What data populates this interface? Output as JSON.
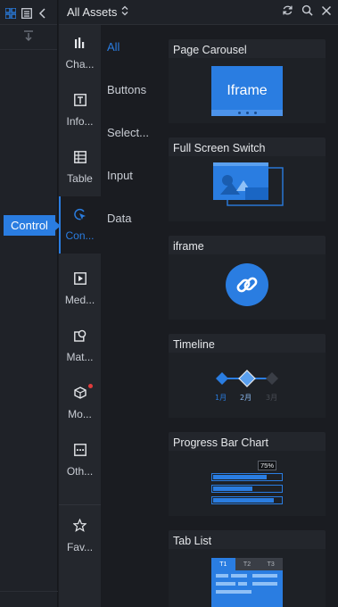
{
  "header": {
    "title": "All Assets"
  },
  "rail": {
    "active_tag": "Control"
  },
  "categories": [
    {
      "label": "Cha..."
    },
    {
      "label": "Info..."
    },
    {
      "label": "Table"
    },
    {
      "label": "Con..."
    },
    {
      "label": "Med..."
    },
    {
      "label": "Mat..."
    },
    {
      "label": "Mo..."
    },
    {
      "label": "Oth..."
    },
    {
      "label": "Fav..."
    }
  ],
  "filters": [
    {
      "label": "All"
    },
    {
      "label": "Buttons"
    },
    {
      "label": "Select..."
    },
    {
      "label": "Input"
    },
    {
      "label": "Data"
    }
  ],
  "cards": [
    {
      "title": "Page Carousel",
      "preview_text": "Iframe"
    },
    {
      "title": "Full Screen Switch"
    },
    {
      "title": "iframe"
    },
    {
      "title": "Timeline",
      "ticks": [
        "1月",
        "2月",
        "3月"
      ]
    },
    {
      "title": "Progress Bar Chart",
      "badge": "75%"
    },
    {
      "title": "Tab List",
      "tabs": [
        "T1",
        "T2",
        "T3"
      ]
    }
  ],
  "colors": {
    "accent": "#2a7de1",
    "background": "#1a1c21",
    "panel": "#24272d"
  }
}
